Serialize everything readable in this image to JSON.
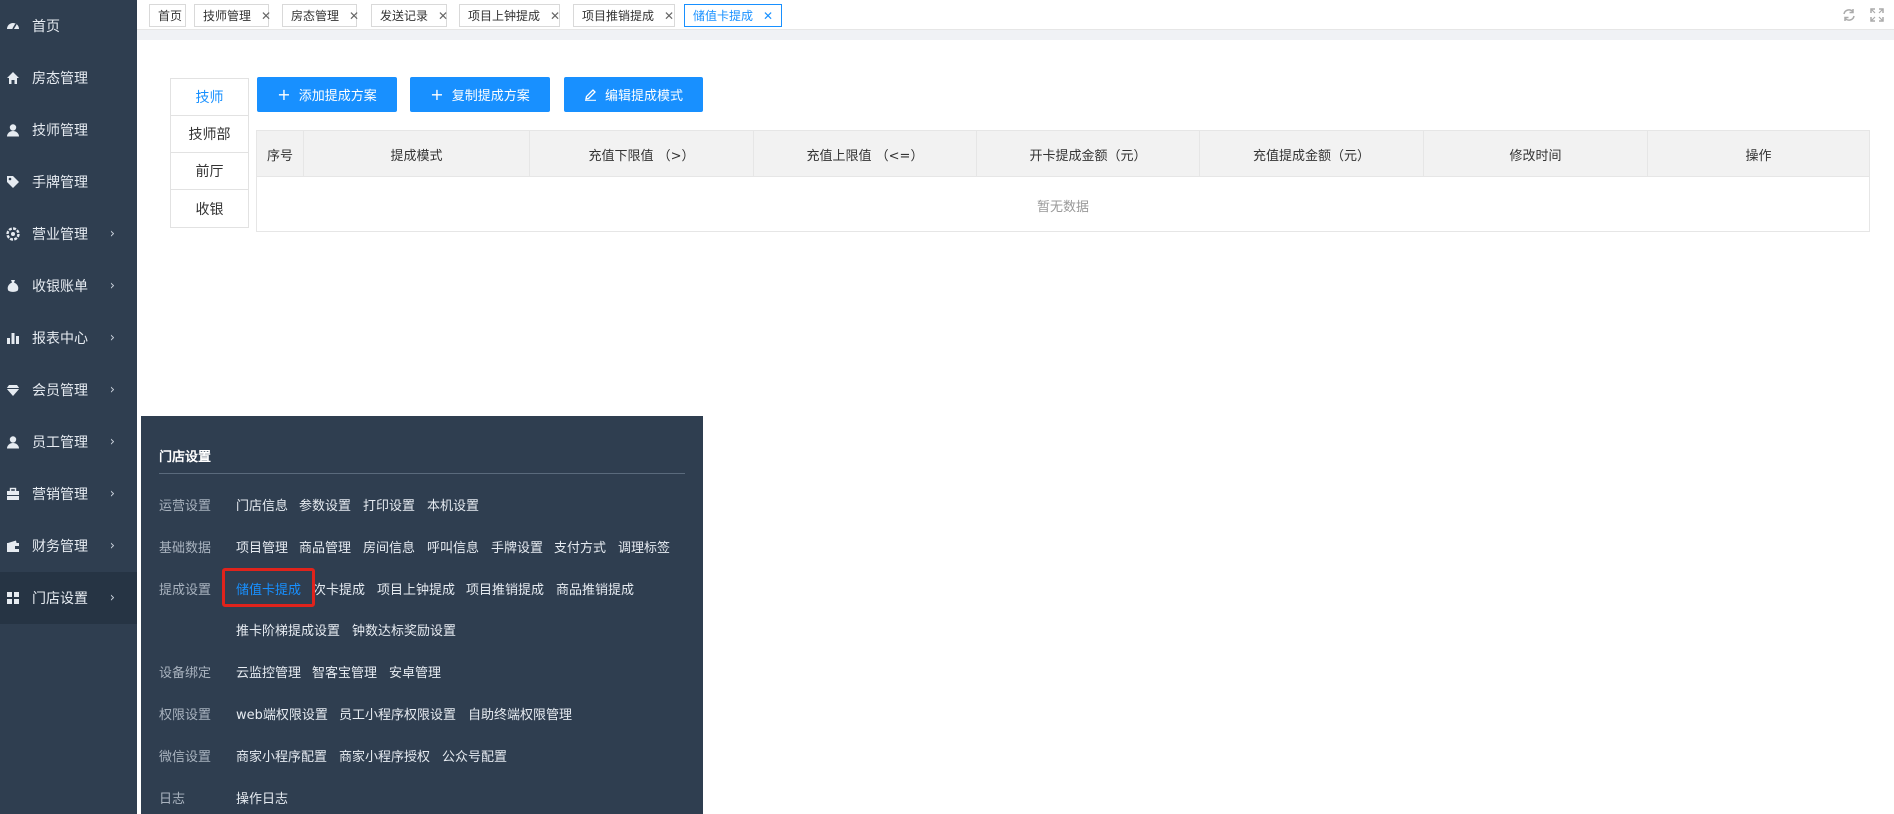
{
  "sidebar": {
    "items": [
      {
        "label": "首页",
        "icon": "dashboard-icon",
        "has_arrow": false
      },
      {
        "label": "房态管理",
        "icon": "home-icon",
        "has_arrow": false
      },
      {
        "label": "技师管理",
        "icon": "user-icon",
        "has_arrow": false
      },
      {
        "label": "手牌管理",
        "icon": "tag-icon",
        "has_arrow": false
      },
      {
        "label": "营业管理",
        "icon": "settings-icon",
        "has_arrow": true
      },
      {
        "label": "收银账单",
        "icon": "money-bag-icon",
        "has_arrow": true
      },
      {
        "label": "报表中心",
        "icon": "bar-chart-icon",
        "has_arrow": true
      },
      {
        "label": "会员管理",
        "icon": "diamond-icon",
        "has_arrow": true
      },
      {
        "label": "员工管理",
        "icon": "user-icon",
        "has_arrow": true
      },
      {
        "label": "营销管理",
        "icon": "briefcase-icon",
        "has_arrow": true
      },
      {
        "label": "财务管理",
        "icon": "wallet-icon",
        "has_arrow": true
      },
      {
        "label": "门店设置",
        "icon": "grid-icon",
        "has_arrow": true,
        "active": true
      }
    ],
    "arrow_glyph": "›"
  },
  "tabs": [
    {
      "label": "首页",
      "closable": false
    },
    {
      "label": "技师管理",
      "closable": true
    },
    {
      "label": "房态管理",
      "closable": true
    },
    {
      "label": "发送记录",
      "closable": true
    },
    {
      "label": "项目上钟提成",
      "closable": true
    },
    {
      "label": "项目推销提成",
      "closable": true
    },
    {
      "label": "储值卡提成",
      "closable": true,
      "active": true
    }
  ],
  "tab_close_glyph": "✕",
  "role_tabs": [
    {
      "label": "技师",
      "active": true
    },
    {
      "label": "技师部"
    },
    {
      "label": "前厅"
    },
    {
      "label": "收银"
    }
  ],
  "buttons": {
    "add_plan": "添加提成方案",
    "copy_plan": "复制提成方案",
    "edit_mode": "编辑提成模式",
    "plus_glyph": "+"
  },
  "table": {
    "headers": [
      "序号",
      "提成模式",
      "充值下限值 （>）",
      "充值上限值 （<=）",
      "开卡提成金额（元）",
      "充值提成金额（元）",
      "修改时间",
      "操作"
    ],
    "empty_text": "暂无数据"
  },
  "flyout": {
    "title": "门店设置",
    "groups": [
      {
        "category": "运营设置",
        "links": [
          "门店信息",
          "参数设置",
          "打印设置",
          "本机设置"
        ]
      },
      {
        "category": "基础数据",
        "links": [
          "项目管理",
          "商品管理",
          "房间信息",
          "呼叫信息",
          "手牌设置",
          "支付方式",
          "调理标签"
        ]
      },
      {
        "category": "提成设置",
        "links": [
          "储值卡提成",
          "次卡提成",
          "项目上钟提成",
          "项目推销提成",
          "商品推销提成"
        ]
      },
      {
        "category": "",
        "links": [
          "推卡阶梯提成设置",
          "钟数达标奖励设置"
        ]
      },
      {
        "category": "设备绑定",
        "links": [
          "云监控管理",
          "智客宝管理",
          "安卓管理"
        ]
      },
      {
        "category": "权限设置",
        "links": [
          "web端权限设置",
          "员工小程序权限设置",
          "自助终端权限管理"
        ]
      },
      {
        "category": "微信设置",
        "links": [
          "商家小程序配置",
          "商家小程序授权",
          "公众号配置"
        ]
      },
      {
        "category": "日志",
        "links": [
          "操作日志"
        ]
      }
    ],
    "active_link": "储值卡提成"
  },
  "colors": {
    "sidebar_bg": "#2f3e50",
    "accent": "#1890ff",
    "highlight": "#e0231c"
  }
}
